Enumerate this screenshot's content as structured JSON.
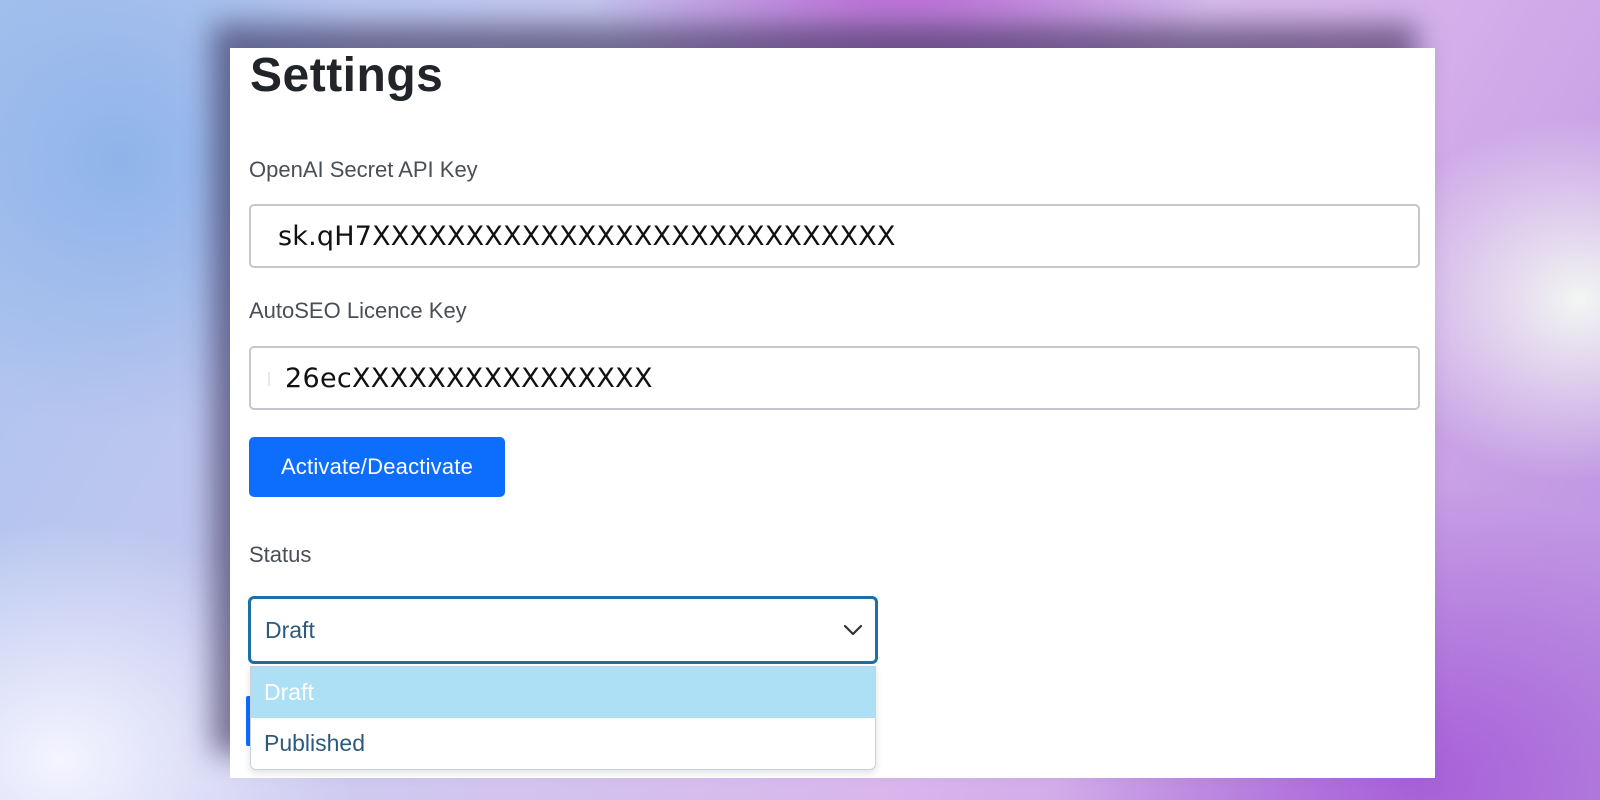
{
  "settings": {
    "title": "Settings"
  },
  "api_key": {
    "label": "OpenAI Secret API Key",
    "value": "sk.qH7XXXXXXXXXXXXXXXXXXXXXXXXXXXX"
  },
  "licence_key": {
    "label": "AutoSEO Licence Key",
    "value": "26ecXXXXXXXXXXXXXXXX"
  },
  "activate_button": {
    "label": "Activate/Deactivate"
  },
  "status": {
    "label": "Status",
    "selected": "Draft",
    "options": [
      "Draft",
      "Published"
    ]
  },
  "colors": {
    "button_blue": "#0d6efd",
    "select_border": "#1d6fa8",
    "option_highlight": "#ade0f4",
    "option_text": "#2c5a7a"
  },
  "icons": {
    "select_arrow": "chevron-down-icon"
  }
}
